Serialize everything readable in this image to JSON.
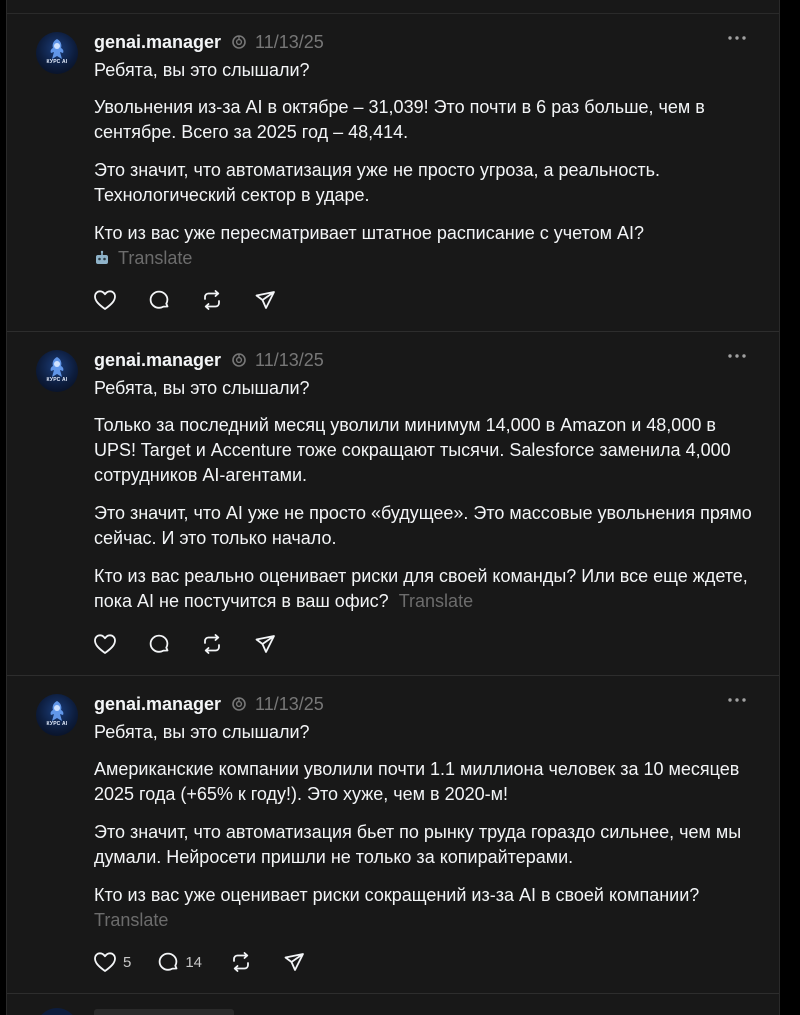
{
  "posts": [
    {
      "username": "genai.manager",
      "date": "11/13/25",
      "avatar_label": "КУРС AI",
      "paragraphs": [
        "Ребята, вы это слышали?",
        "Увольнения из-за AI в октябре – 31,039! Это почти в 6 раз больше, чем в сентябре. Всего за 2025 год – 48,414.",
        "Это значит, что автоматизация уже не просто угроза, а реальность. Технологический сектор в ударе.",
        "Кто из вас уже пересматривает штатное расписание с учетом AI?"
      ],
      "translate_label": "Translate",
      "like_count": "",
      "reply_count": ""
    },
    {
      "username": "genai.manager",
      "date": "11/13/25",
      "avatar_label": "КУРС AI",
      "paragraphs": [
        "Ребята, вы это слышали?",
        "Только за последний месяц уволили минимум 14,000 в Amazon и 48,000 в UPS! Target и Accenture тоже сокращают тысячи. Salesforce заменила 4,000 сотрудников AI-агентами.",
        "Это значит, что AI уже не просто «будущее». Это массовые увольнения прямо сейчас. И это только начало.",
        "Кто из вас реально оценивает риски для своей команды? Или все еще ждете, пока AI не постучится в ваш офис?"
      ],
      "translate_label": "Translate",
      "like_count": "",
      "reply_count": ""
    },
    {
      "username": "genai.manager",
      "date": "11/13/25",
      "avatar_label": "КУРС AI",
      "paragraphs": [
        "Ребята, вы это слышали?",
        "Американские компании уволили почти 1.1 миллиона человек за 10 месяцев 2025 года (+65% к году!). Это хуже, чем в 2020-м!",
        "Это значит, что автоматизация бьет по рынку труда гораздо сильнее, чем мы думали. Нейросети пришли не только за копирайтерами.",
        "Кто из вас уже оценивает риски сокращений из-за AI в своей компании?"
      ],
      "translate_label": "Translate",
      "like_count": "5",
      "reply_count": "14"
    }
  ],
  "icons": {
    "like": "heart-icon",
    "reply": "comment-bubble-icon",
    "repost": "repost-icon",
    "share": "send-icon",
    "more": "more-dots-icon",
    "ai_badge": "ai-label-icon",
    "translate": "robot-translate-icon"
  },
  "colors": {
    "background": "#181818",
    "text": "#f3f5f7",
    "muted": "#777777",
    "divider": "#2d2d2d"
  }
}
